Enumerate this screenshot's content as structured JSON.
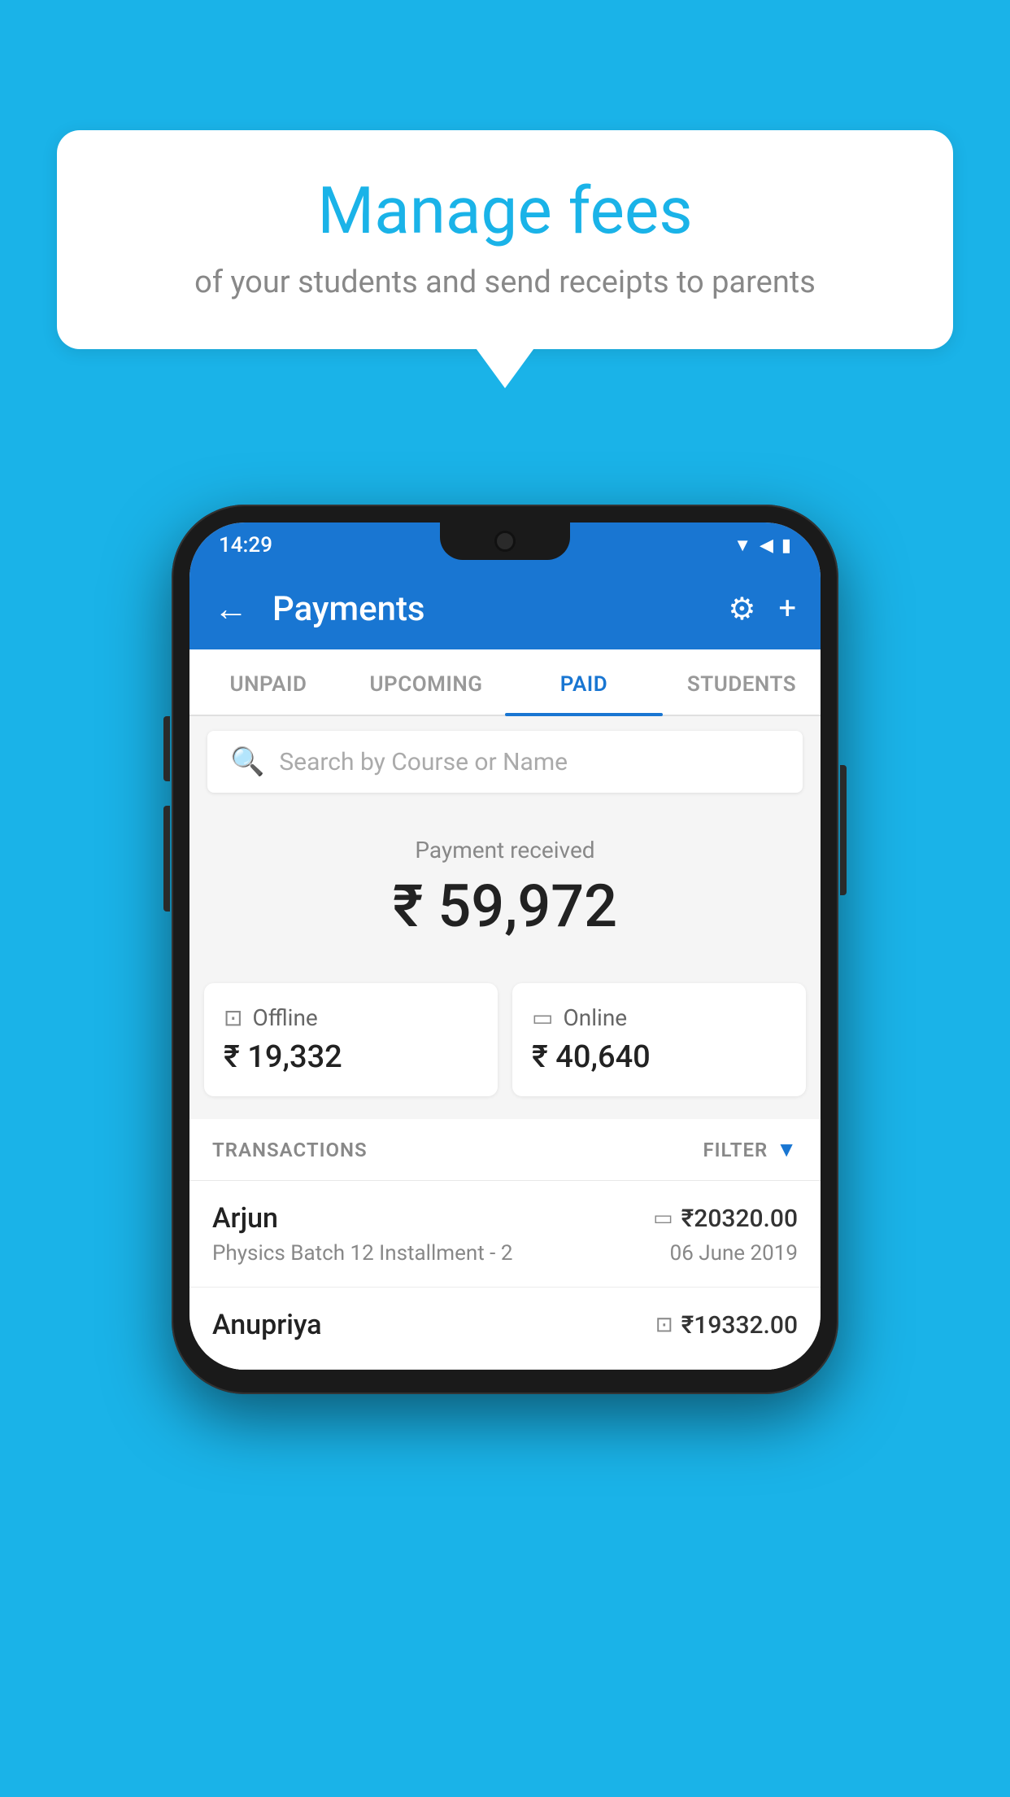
{
  "background_color": "#1ab3e8",
  "speech_bubble": {
    "title": "Manage fees",
    "subtitle": "of your students and send receipts to parents"
  },
  "status_bar": {
    "time": "14:29",
    "icons": [
      "wifi",
      "signal",
      "battery"
    ]
  },
  "app_bar": {
    "title": "Payments",
    "back_label": "←",
    "gear_label": "⚙",
    "plus_label": "+"
  },
  "tabs": [
    {
      "label": "UNPAID",
      "active": false
    },
    {
      "label": "UPCOMING",
      "active": false
    },
    {
      "label": "PAID",
      "active": true
    },
    {
      "label": "STUDENTS",
      "active": false
    }
  ],
  "search": {
    "placeholder": "Search by Course or Name"
  },
  "payment_received": {
    "label": "Payment received",
    "amount": "₹ 59,972"
  },
  "payment_cards": [
    {
      "icon": "offline",
      "label": "Offline",
      "amount": "₹ 19,332"
    },
    {
      "icon": "online",
      "label": "Online",
      "amount": "₹ 40,640"
    }
  ],
  "transactions": {
    "header_label": "TRANSACTIONS",
    "filter_label": "FILTER"
  },
  "transaction_rows": [
    {
      "name": "Arjun",
      "course": "Physics Batch 12 Installment - 2",
      "amount": "₹20320.00",
      "date": "06 June 2019",
      "payment_type": "online"
    },
    {
      "name": "Anupriya",
      "course": "",
      "amount": "₹19332.00",
      "date": "",
      "payment_type": "offline"
    }
  ]
}
